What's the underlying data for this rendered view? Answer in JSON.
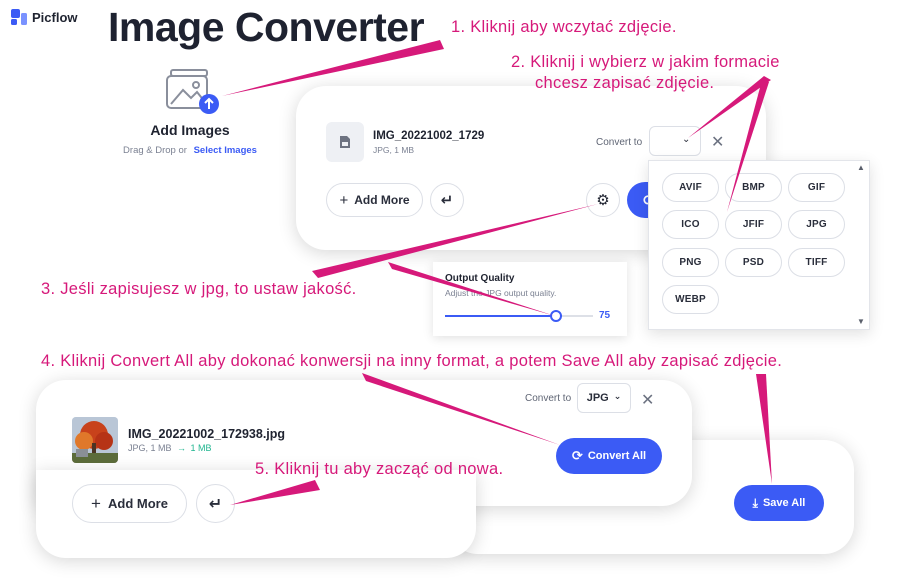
{
  "brand": {
    "name": "Picflow"
  },
  "title": "Image Converter",
  "upload": {
    "heading": "Add Images",
    "hint": "Drag & Drop or",
    "link": "Select Images"
  },
  "panel1": {
    "file_name": "IMG_20221002_1729",
    "file_meta": "JPG, 1 MB",
    "convert_to_label": "Convert to",
    "add_more": "Add More"
  },
  "formats": [
    "AVIF",
    "BMP",
    "GIF",
    "ICO",
    "JFIF",
    "JPG",
    "PNG",
    "PSD",
    "TIFF",
    "WEBP"
  ],
  "quality": {
    "title": "Output Quality",
    "subtitle": "Adjust the JPG output quality.",
    "value": 75
  },
  "panel2": {
    "convert_to_label": "Convert to",
    "format": "JPG",
    "file_name": "IMG_20221002_172938.jpg",
    "file_meta": "JPG, 1 MB",
    "arrow": "→",
    "new_size": "1 MB",
    "convert_all": "Convert All",
    "add_more": "Add More",
    "save_all": "Save All"
  },
  "annotations": {
    "a1": "1. Kliknij aby wczytać zdjęcie.",
    "a2_line1": "2. Kliknij i wybierz w jakim formacie",
    "a2_line2": "chcesz zapisać zdjęcie.",
    "a3": "3. Jeśli zapisujesz w jpg, to ustaw jakość.",
    "a4": "4. Kliknij Convert All aby dokonać konwersji na inny format, a potem Save All aby zapisać zdjęcie.",
    "a5": "5. Kliknij tu aby zacząć od nowa."
  },
  "colors": {
    "accent": "#3b5bf5",
    "annotation": "#d6197a",
    "success": "#1fb58f"
  }
}
